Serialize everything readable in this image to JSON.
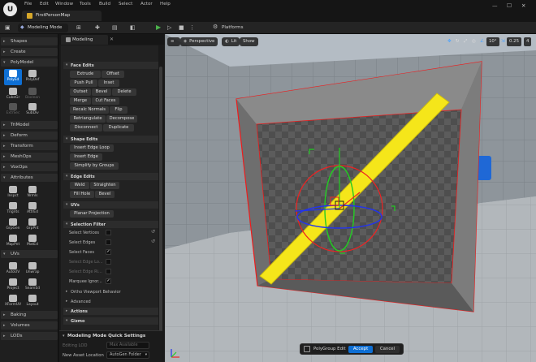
{
  "app": {
    "logo_letter": "U",
    "menu": [
      "File",
      "Edit",
      "Window",
      "Tools",
      "Build",
      "Select",
      "Actor",
      "Help"
    ],
    "document_tab": "FirstPersonMap"
  },
  "toolbar": {
    "mode_label": "Modeling Mode",
    "platforms_label": "Platforms"
  },
  "palette": {
    "categories": {
      "shapes": "Shapes",
      "create": "Create",
      "polymodel": "PolyModel",
      "trimodel": "TriModel",
      "deform": "Deform",
      "transform": "Transform",
      "meshops": "MeshOps",
      "voxops": "VoxOps",
      "attributes": "Attributes",
      "uvs": "UVs",
      "baking": "Baking",
      "volumes": "Volumes",
      "lods": "LODs"
    },
    "polymodel_tools": [
      "PolyEd",
      "PolyDef",
      "CubeGr",
      "Boolean",
      "ExtrSec",
      "SubDiv"
    ],
    "attribute_tools": [
      "Inspct",
      "Nrmls",
      "Tngnts",
      "AttrEd",
      "GrpGen",
      "GrpPnt",
      "MapPnt",
      "MatEd"
    ],
    "uv_tools": [
      "AutoUV",
      "Unwrap",
      "Project",
      "SeamEd",
      "XFormUV",
      "Layout"
    ]
  },
  "details": {
    "tab_label": "Modeling",
    "sections": {
      "face_edits": "Face Edits",
      "shape_edits": "Shape Edits",
      "edge_edits": "Edge Edits",
      "uvs": "UVs",
      "selection_filter": "Selection Filter",
      "ortho": "Ortho Viewport Behavior",
      "advanced": "Advanced",
      "actions": "Actions",
      "gizmo": "Gizmo"
    },
    "face_buttons": [
      "Extrude",
      "Offset",
      "Push Pull",
      "Inset",
      "Outset",
      "Bevel",
      "Delete",
      "Merge",
      "Cut Faces",
      "Recalc Normals",
      "Flip",
      "Retriangulate",
      "Decompose",
      "Disconnect",
      "Duplicate"
    ],
    "shape_buttons": [
      "Insert Edge Loop",
      "Insert Edge",
      "Simplify by Groups"
    ],
    "edge_buttons": [
      "Weld",
      "Straighten",
      "Fill Hole",
      "Bevel"
    ],
    "uv_buttons": [
      "Planar Projection"
    ],
    "filter_props": [
      "Select Vertices",
      "Select Edges",
      "Select Faces",
      "Select Edge Lo...",
      "Select Edge Ri...",
      "Marquee Ignor..."
    ],
    "check_mark": "✓",
    "reset_glyph": "↺"
  },
  "quick_settings": {
    "title": "Modeling Mode Quick Settings",
    "editing_lod_label": "Editing LOD",
    "editing_lod_value": "Max Available",
    "new_asset_label": "New Asset Location",
    "new_asset_value": "AutoGen Folder"
  },
  "viewport": {
    "perspective_label": "Perspective",
    "lit_label": "Lit",
    "show_label": "Show",
    "angle_value": "10°",
    "scale_value": "0.25",
    "cam_speed": "4",
    "colors": {
      "selected_edge": "#ee1c1c",
      "face_highlight": "#f5e61a",
      "gizmo_red": "#ee2222",
      "gizmo_green": "#22cc22",
      "gizmo_blue": "#2233ee",
      "accent_blue": "#0e6fd4"
    }
  },
  "accept_bar": {
    "label": "PolyGroup Edit",
    "accept": "Accept",
    "cancel": "Cancel"
  }
}
